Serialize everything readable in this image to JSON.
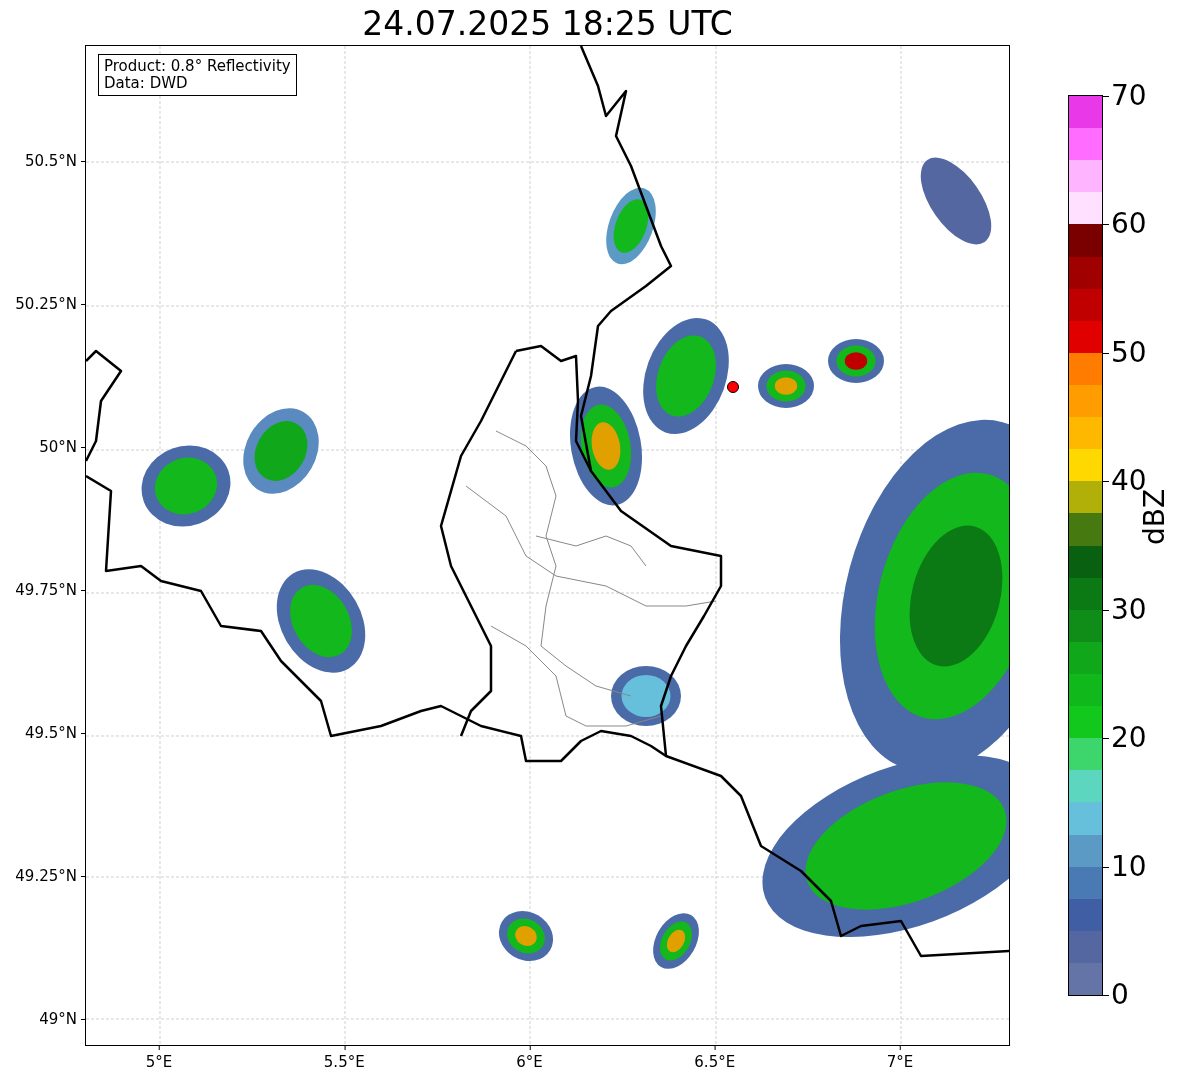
{
  "title": "24.07.2025 18:25 UTC",
  "info_box": [
    "Product: 0.8° Reflectivity",
    "Data: DWD"
  ],
  "map": {
    "lat_ticks": [
      "50.5°N",
      "50.25°N",
      "50°N",
      "49.75°N",
      "49.5°N",
      "49.25°N",
      "49°N"
    ],
    "lon_ticks": [
      "5°E",
      "5.5°E",
      "6°E",
      "6.5°E",
      "7°E"
    ]
  },
  "colorbar": {
    "label": "dBZ",
    "ticks": [
      "70",
      "60",
      "50",
      "40",
      "30",
      "20",
      "10",
      "0"
    ],
    "bins": [
      {
        "color": "#e838e8"
      },
      {
        "color": "#ff6cff"
      },
      {
        "color": "#ffb4ff"
      },
      {
        "color": "#ffe0ff"
      },
      {
        "color": "#7a0000"
      },
      {
        "color": "#a00000"
      },
      {
        "color": "#c00000"
      },
      {
        "color": "#e00000"
      },
      {
        "color": "#ff7c00"
      },
      {
        "color": "#ff9c00"
      },
      {
        "color": "#ffb800"
      },
      {
        "color": "#ffd800"
      },
      {
        "color": "#b0b008"
      },
      {
        "color": "#467a10"
      },
      {
        "color": "#086010"
      },
      {
        "color": "#0c7a14"
      },
      {
        "color": "#108c18"
      },
      {
        "color": "#10a81a"
      },
      {
        "color": "#10b81c"
      },
      {
        "color": "#12c81c"
      },
      {
        "color": "#3dd66c"
      },
      {
        "color": "#5dd6c0"
      },
      {
        "color": "#66c0dc"
      },
      {
        "color": "#5a9ac5"
      },
      {
        "color": "#4a7ab3"
      },
      {
        "color": "#3f5ea4"
      },
      {
        "color": "#5567a0"
      },
      {
        "color": "#6474a6"
      }
    ]
  }
}
